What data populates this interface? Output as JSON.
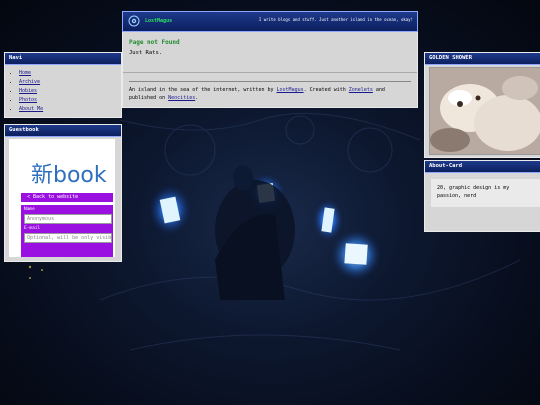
{
  "header": {
    "site_name": "LostMagus",
    "tagline": "I write blogs and stuff. Just another island in the ocean, okay!"
  },
  "main": {
    "title": "Page not Found",
    "text": "Just Rats.",
    "footer": {
      "prefix": "An island in the sea of the internet, written by ",
      "author": "LostMagus",
      "middle": ". Created with ",
      "generator": "Zonelets",
      "and": " and",
      "published": "published on ",
      "host": "Neocities",
      "end": "."
    }
  },
  "navi": {
    "title": "Navi",
    "items": [
      {
        "label": "Home"
      },
      {
        "label": "Archive"
      },
      {
        "label": "Hobies"
      },
      {
        "label": "Photos"
      },
      {
        "label": "About Me"
      }
    ]
  },
  "guestbook": {
    "title": "Guestbook",
    "logo": "新book",
    "back_label": "< Back to website",
    "name_label": "Name",
    "name_placeholder": "Anonymous",
    "email_label": "E-mail",
    "email_placeholder": "Optional, will be only visible t"
  },
  "golden": {
    "title": "GOLDEN SHOWER"
  },
  "about": {
    "title": "About-Card",
    "text": "20, graphic design is my passion, nerd"
  }
}
